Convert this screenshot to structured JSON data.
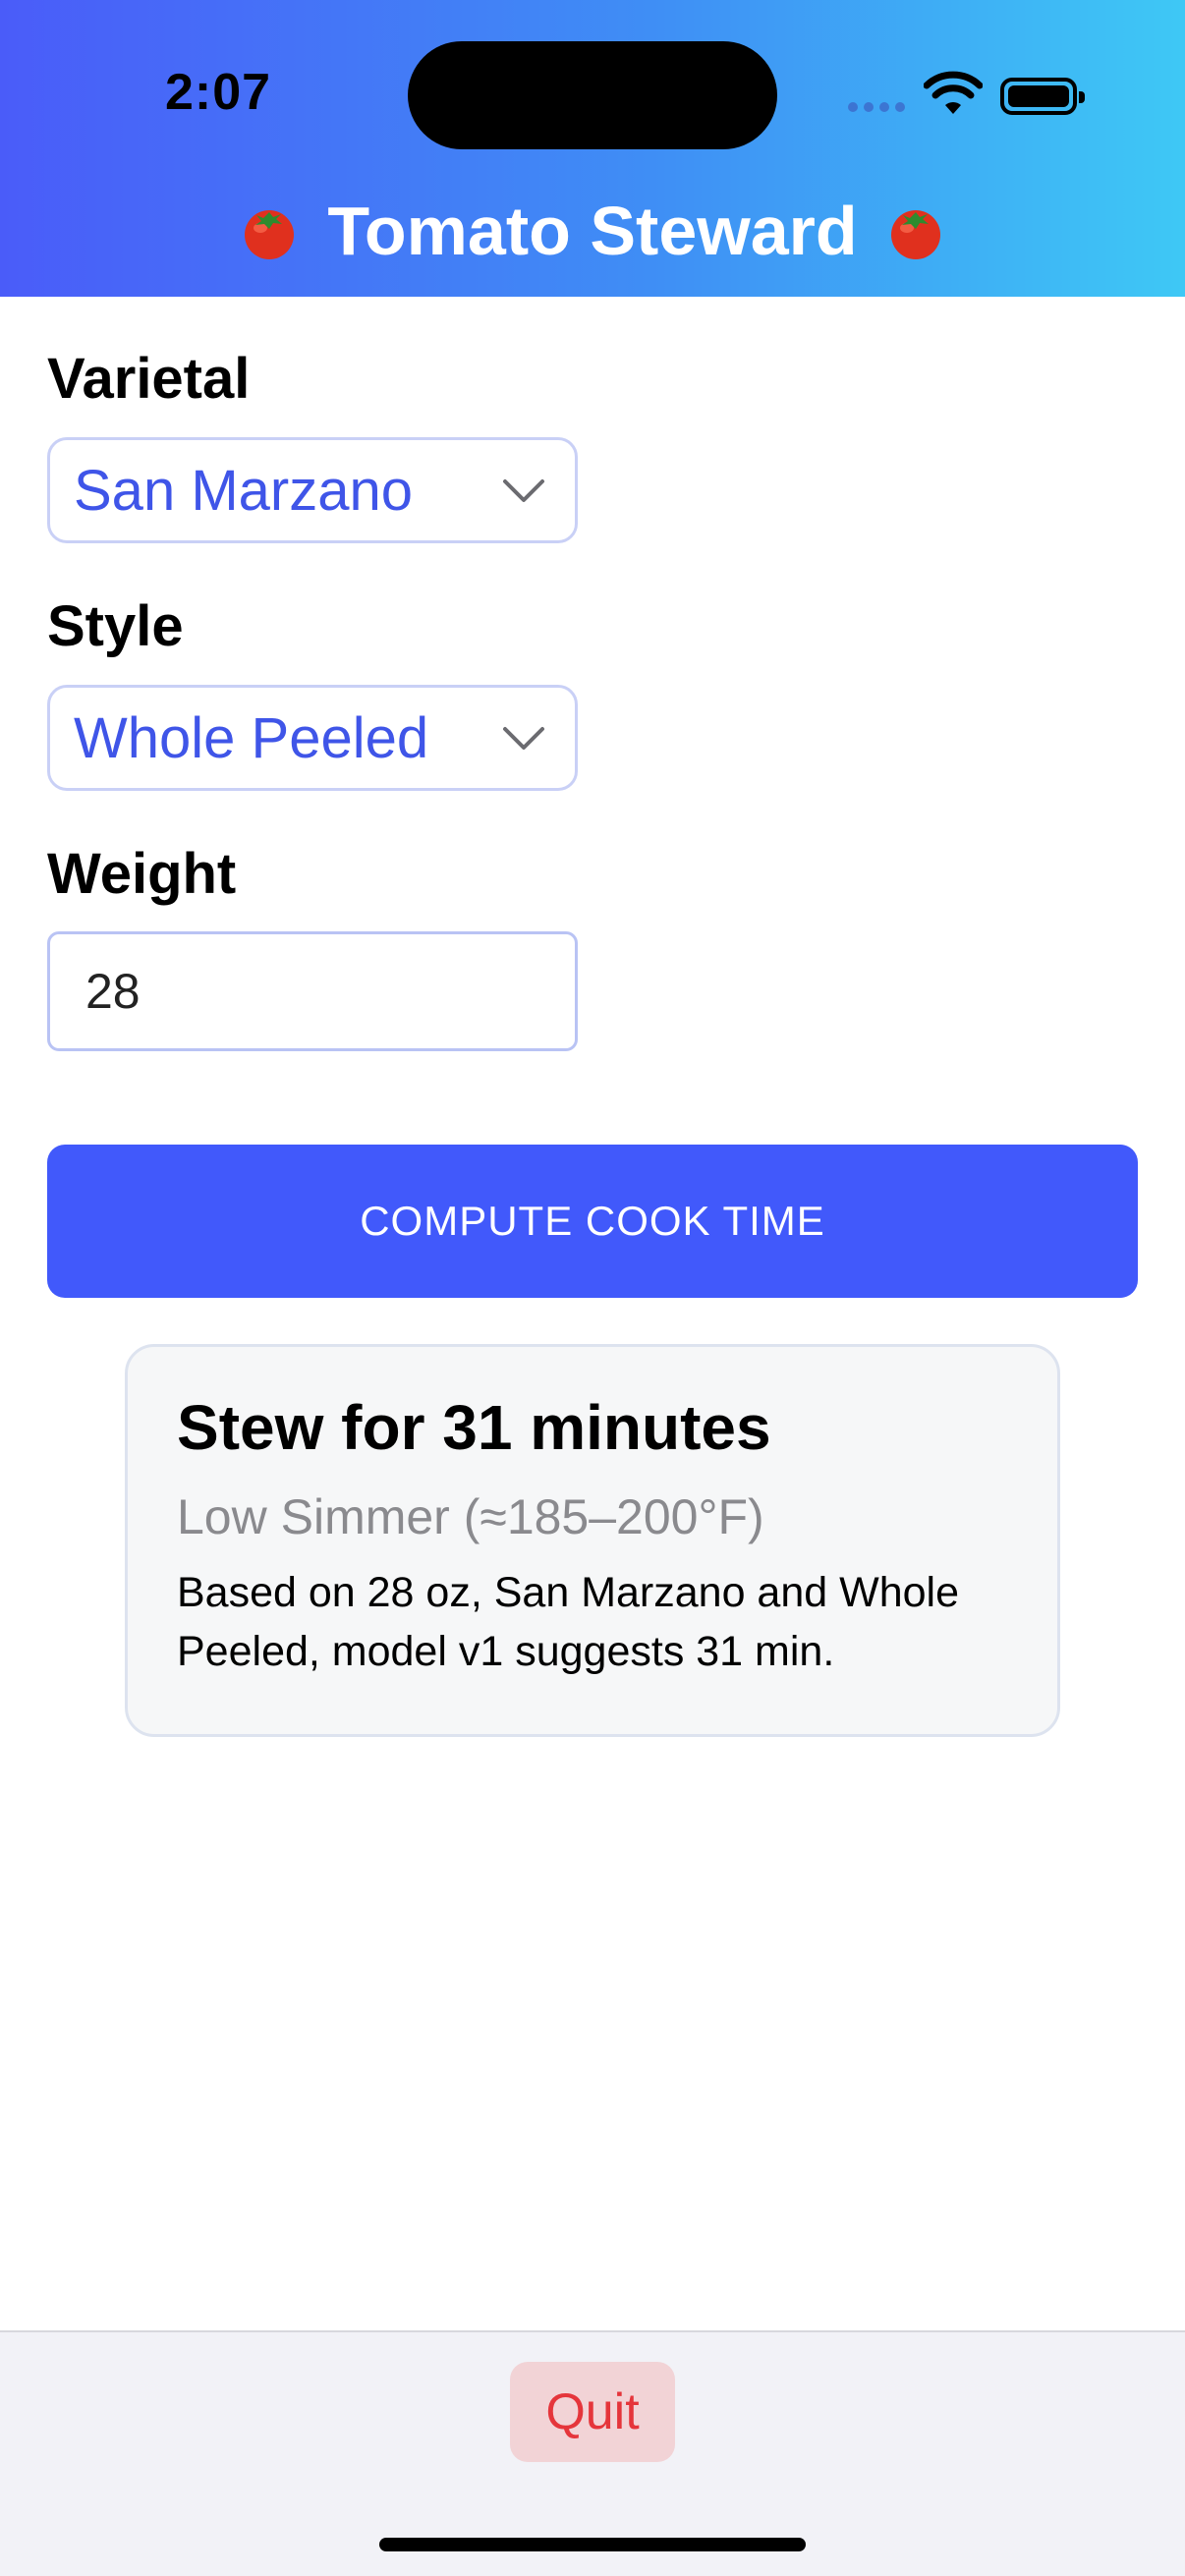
{
  "status_bar": {
    "time": "2:07"
  },
  "header": {
    "title": "Tomato Steward",
    "icon": "tomato-icon"
  },
  "form": {
    "varietal": {
      "label": "Varietal",
      "value": "San Marzano"
    },
    "style": {
      "label": "Style",
      "value": "Whole Peeled"
    },
    "weight": {
      "label": "Weight",
      "value": "28"
    }
  },
  "actions": {
    "compute_label": "COMPUTE COOK TIME",
    "quit_label": "Quit"
  },
  "result": {
    "title": "Stew for 31 minutes",
    "subtitle": "Low Simmer (≈185–200°F)",
    "body": "Based on 28 oz, San Marzano and Whole Peeled, model v1 suggests 31 min."
  },
  "colors": {
    "accent": "#4159fb",
    "select_text": "#3f55e8",
    "quit_text": "#e5353b",
    "quit_bg": "#f2d3d6"
  }
}
